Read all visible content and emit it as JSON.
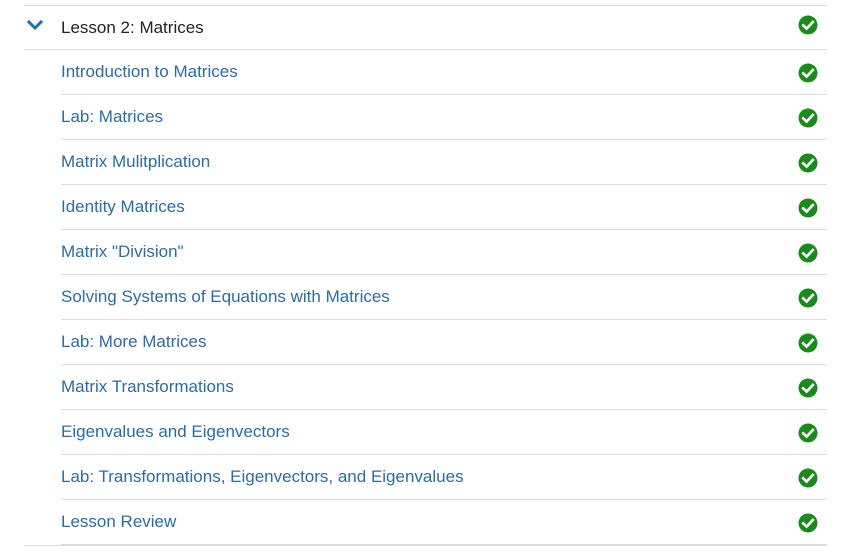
{
  "lesson": {
    "title": "Lesson 2: Matrices",
    "expanded": true,
    "completed": true
  },
  "items": [
    {
      "label": "Introduction to Matrices",
      "completed": true
    },
    {
      "label": "Lab: Matrices",
      "completed": true
    },
    {
      "label": "Matrix Mulitplication",
      "completed": true
    },
    {
      "label": "Identity Matrices",
      "completed": true
    },
    {
      "label": "Matrix \"Division\"",
      "completed": true
    },
    {
      "label": "Solving Systems of Equations with Matrices",
      "completed": true
    },
    {
      "label": "Lab: More Matrices",
      "completed": true
    },
    {
      "label": "Matrix Transformations",
      "completed": true
    },
    {
      "label": "Eigenvalues and Eigenvectors",
      "completed": true
    },
    {
      "label": "Lab: Transformations, Eigenvectors, and Eigenvalues",
      "completed": true
    },
    {
      "label": "Lesson Review",
      "completed": true
    }
  ],
  "colors": {
    "link": "#2a6da3",
    "check": "#1a8a1a",
    "chevron": "#1f6fb2",
    "divider": "#dcdcdc"
  },
  "icons": {
    "expand": "chevron-down-icon",
    "status": "check-circle-icon"
  }
}
